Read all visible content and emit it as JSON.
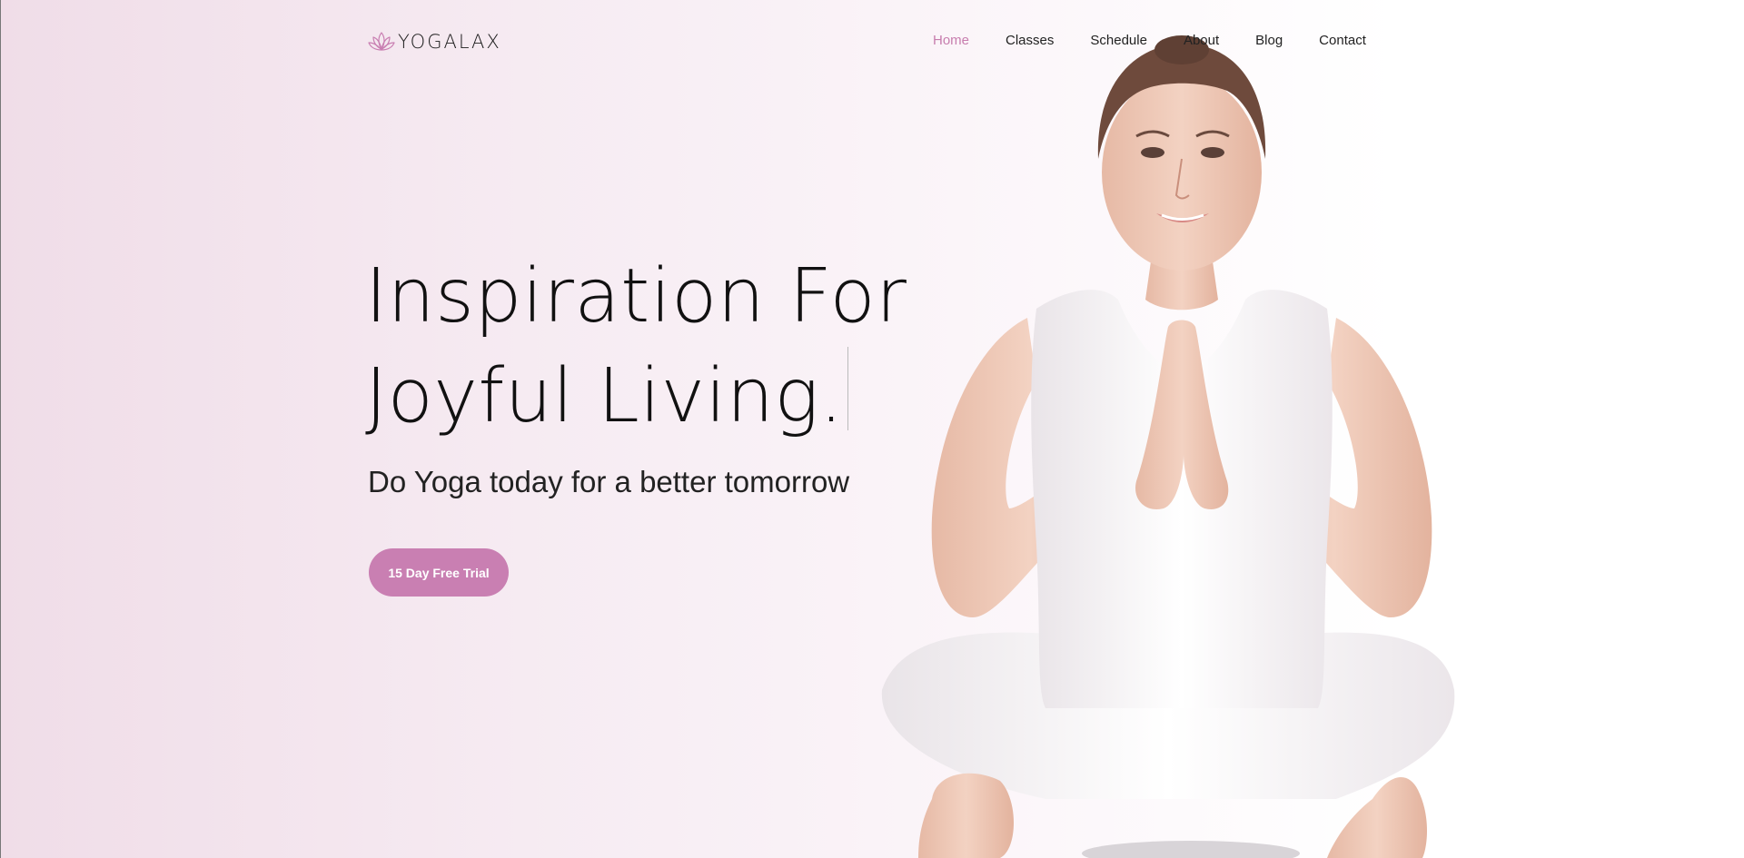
{
  "brand": {
    "name": "YOGALAX",
    "logo_icon": "lotus-icon",
    "accent_color": "#c97fb2"
  },
  "nav": {
    "items": [
      {
        "label": "Home",
        "active": true
      },
      {
        "label": "Classes",
        "active": false
      },
      {
        "label": "Schedule",
        "active": false
      },
      {
        "label": "About",
        "active": false
      },
      {
        "label": "Blog",
        "active": false
      },
      {
        "label": "Contact",
        "active": false
      }
    ]
  },
  "hero": {
    "title_line1": "Inspiration For",
    "title_line2": "Joyful Living.",
    "subtitle": "Do Yoga today for a better tomorrow",
    "cta_label": "15 Day Free Trial"
  }
}
